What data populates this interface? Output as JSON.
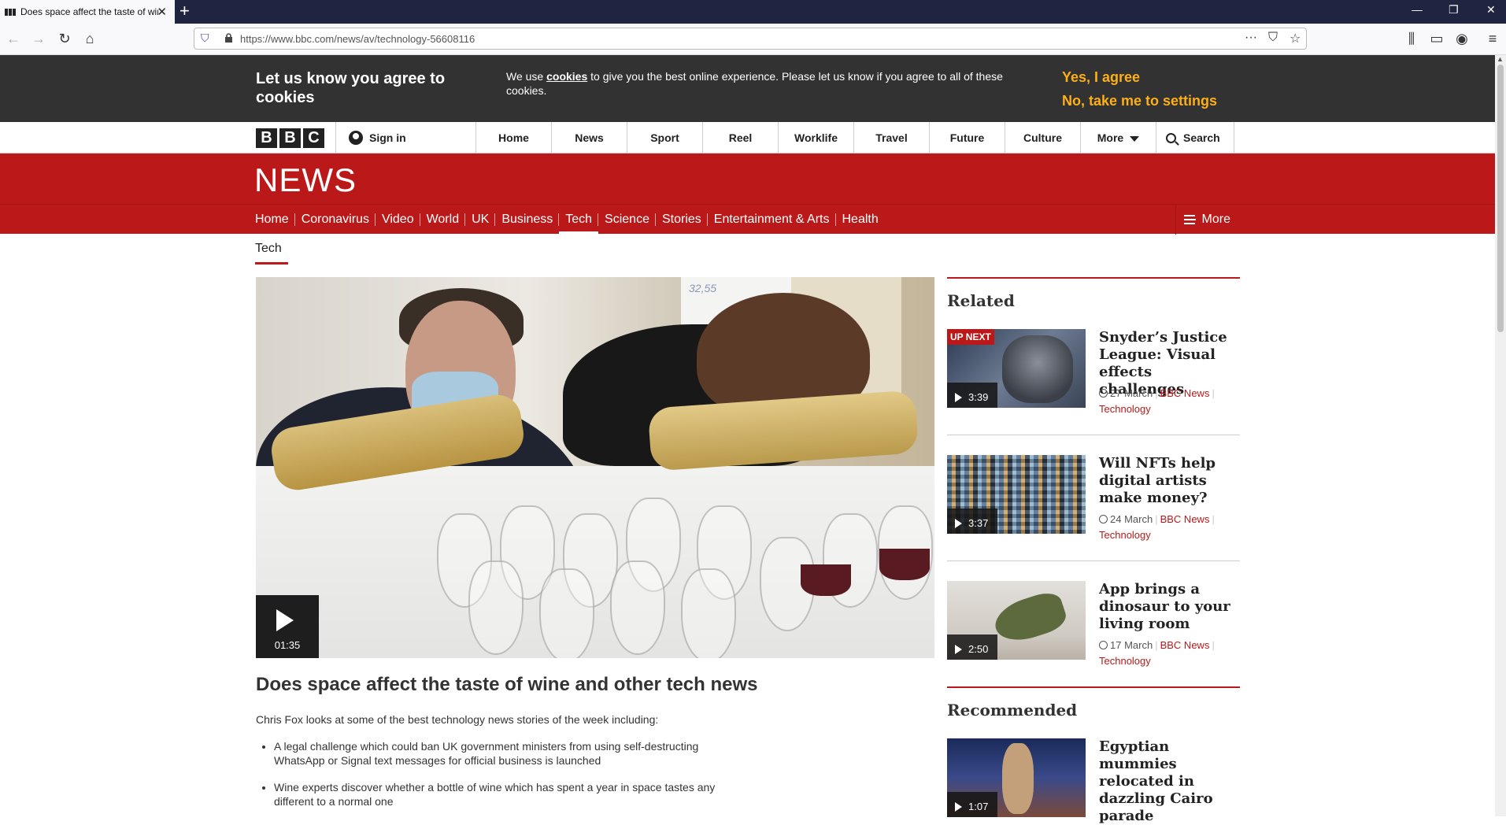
{
  "browser": {
    "tab_title": "Does space affect the taste of wine and other tech news",
    "url": "https://www.bbc.com/news/av/technology-56608116",
    "new_tab": "+",
    "close_tab": "✕"
  },
  "cookie_banner": {
    "title": "Let us know you agree to cookies",
    "text_before": "We use ",
    "text_link": "cookies",
    "text_after": " to give you the best online experience. Please let us know if you agree to all of these cookies.",
    "accept_label": "Yes, I agree",
    "settings_label": "No, take me to settings"
  },
  "bbc_nav": {
    "logo_letters": [
      "B",
      "B",
      "C"
    ],
    "sign_in": "Sign in",
    "items": [
      "Home",
      "News",
      "Sport",
      "Reel",
      "Worklife",
      "Travel",
      "Future",
      "Culture"
    ],
    "more": "More",
    "search": "Search"
  },
  "news": {
    "logo": "NEWS",
    "subnav": [
      "Home",
      "Coronavirus",
      "Video",
      "World",
      "UK",
      "Business",
      "Tech",
      "Science",
      "Stories",
      "Entertainment & Arts",
      "Health"
    ],
    "active_index": 6,
    "more": "More"
  },
  "section": "Tech",
  "video": {
    "duration": "01:35",
    "board_text": "32,55"
  },
  "article": {
    "headline": "Does space affect the taste of wine and other tech news",
    "lede": "Chris Fox looks at some of the best technology news stories of the week including:",
    "bullets": [
      "A legal challenge which could ban UK government ministers from using self-destructing WhatsApp or Signal text messages for official business is launched",
      "Wine experts discover whether a bottle of wine which has spent a year in space tastes any different to a normal one"
    ]
  },
  "related": {
    "heading": "Related",
    "items": [
      {
        "title": "Snyder’s Justice League: Visual effects challenges",
        "duration": "3:39",
        "date": "27 March",
        "source": "BBC News",
        "category": "Technology",
        "badge": "UP NEXT"
      },
      {
        "title": "Will NFTs help digital artists make money?",
        "duration": "3:37",
        "date": "24 March",
        "source": "BBC News",
        "category": "Technology"
      },
      {
        "title": "App brings a dinosaur to your living room",
        "duration": "2:50",
        "date": "17 March",
        "source": "BBC News",
        "category": "Technology"
      }
    ]
  },
  "recommended": {
    "heading": "Recommended",
    "items": [
      {
        "title": "Egyptian mummies relocated in dazzling Cairo parade",
        "duration": "1:07"
      }
    ]
  }
}
